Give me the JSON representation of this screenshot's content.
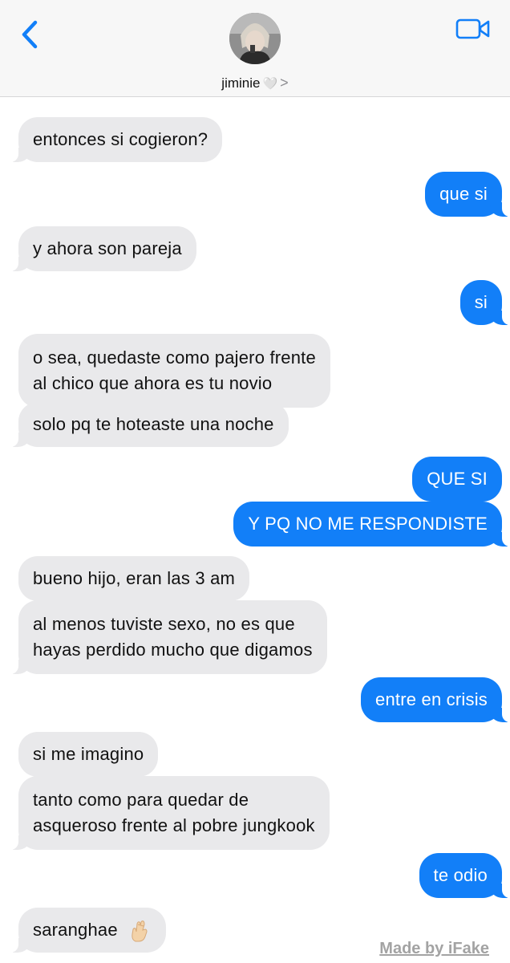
{
  "header": {
    "contact_name": "jiminie",
    "heart": "🤍",
    "chevron": ">"
  },
  "colors": {
    "accent": "#127ff8",
    "incoming_bubble": "#e9e9eb",
    "header_bg": "#f7f7f7"
  },
  "icons": {
    "back": "back-chevron-icon",
    "video": "video-camera-icon",
    "emoji": "crossed-fingers-emoji"
  },
  "messages": [
    {
      "side": "in",
      "text": "entonces si cogieron?"
    },
    {
      "side": "out",
      "text": "que si"
    },
    {
      "side": "in",
      "text": "y ahora son pareja"
    },
    {
      "side": "out",
      "text": "si"
    },
    {
      "side": "in",
      "lines": [
        "o sea, quedaste como pajero frente",
        "al chico que ahora es tu novio"
      ]
    },
    {
      "side": "in",
      "text": "solo pq te hoteaste una noche"
    },
    {
      "side": "out",
      "text": "QUE SI"
    },
    {
      "side": "out",
      "text": "Y PQ NO ME RESPONDISTE"
    },
    {
      "side": "in",
      "text": "bueno hijo, eran las 3 am"
    },
    {
      "side": "in",
      "lines": [
        "al menos tuviste sexo, no es que",
        "hayas perdido mucho que digamos"
      ]
    },
    {
      "side": "out",
      "text": "entre en crisis"
    },
    {
      "side": "in",
      "text": "si me imagino"
    },
    {
      "side": "in",
      "lines": [
        "tanto como para quedar de",
        "asqueroso frente al pobre jungkook"
      ]
    },
    {
      "side": "out",
      "text": "te odio"
    },
    {
      "side": "in",
      "text": "saranghae"
    }
  ],
  "watermark": "Made by iFake"
}
